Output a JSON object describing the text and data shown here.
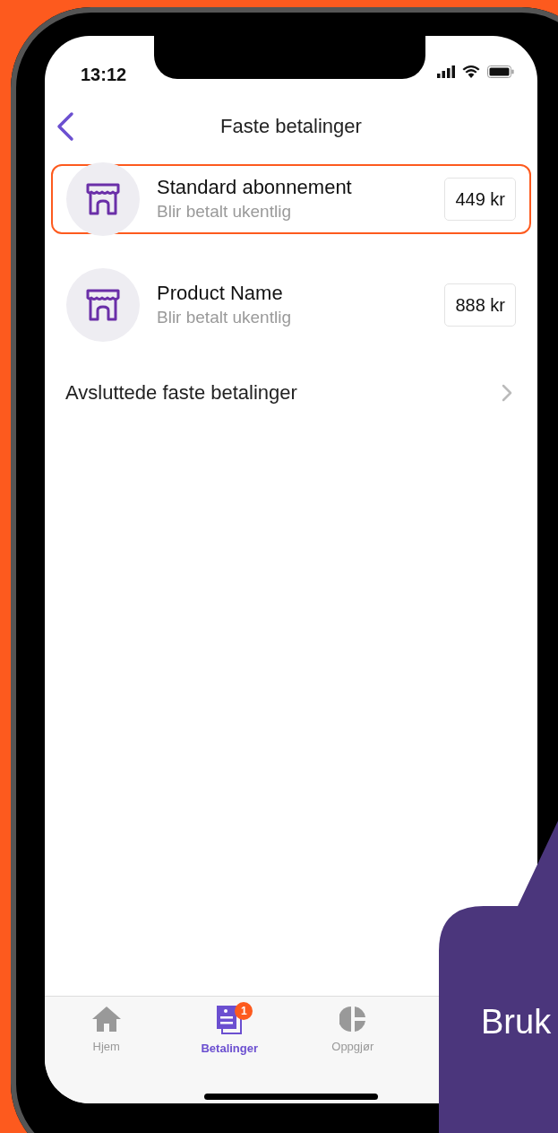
{
  "status_bar": {
    "time": "13:12"
  },
  "header": {
    "title": "Faste betalinger"
  },
  "payments": [
    {
      "name": "Standard abonnement",
      "frequency": "Blir betalt ukentlig",
      "amount": "449 kr",
      "highlighted": true
    },
    {
      "name": "Product Name",
      "frequency": "Blir betalt ukentlig",
      "amount": "888 kr",
      "highlighted": false
    }
  ],
  "ended_link": {
    "label": "Avsluttede faste betalinger"
  },
  "tab_bar": [
    {
      "kind": "home",
      "label": "Hjem",
      "selected": false
    },
    {
      "kind": "payments",
      "label": "Betalinger",
      "selected": true,
      "badge": "1"
    },
    {
      "kind": "settlement",
      "label": "Oppgjør",
      "selected": false
    }
  ],
  "callout": {
    "text": "Bruk"
  }
}
